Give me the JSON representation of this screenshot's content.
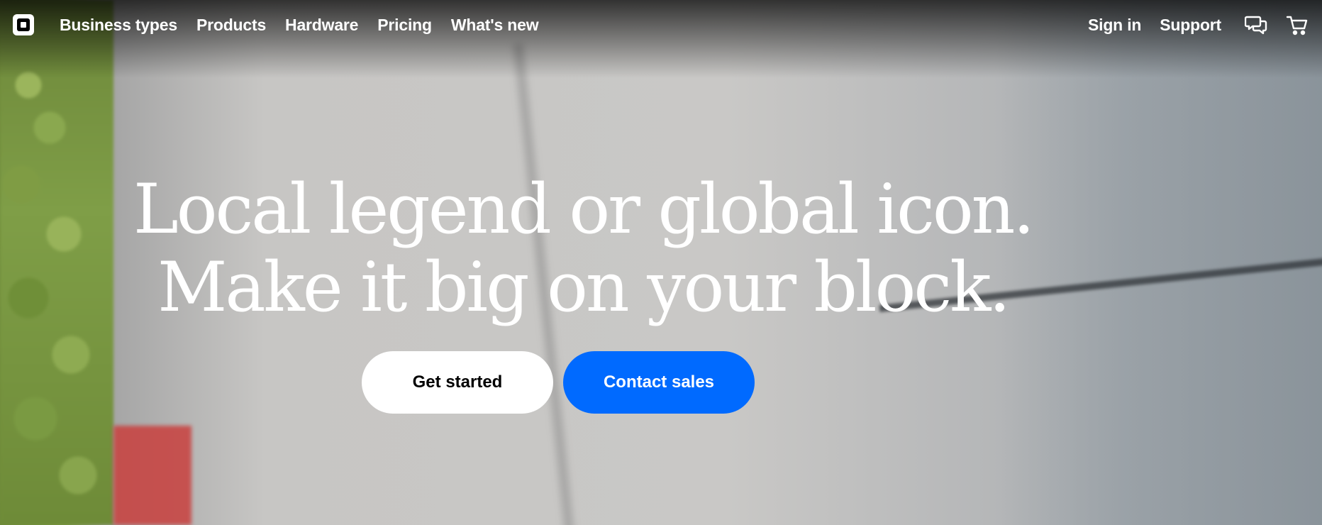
{
  "nav": {
    "logo_icon": "square-logo-icon",
    "links": [
      {
        "label": "Business types"
      },
      {
        "label": "Products"
      },
      {
        "label": "Hardware"
      },
      {
        "label": "Pricing"
      },
      {
        "label": "What's new"
      }
    ],
    "right": {
      "sign_in": "Sign in",
      "support": "Support",
      "chat_icon": "chat-bubbles-icon",
      "cart_icon": "cart-icon"
    }
  },
  "hero": {
    "title_line1": "Local legend or global icon.",
    "title_line2": "Make it big on your block.",
    "primary_cta": "Get started",
    "secondary_cta": "Contact sales"
  },
  "colors": {
    "accent_blue": "#006aff",
    "text_white": "#ffffff"
  }
}
